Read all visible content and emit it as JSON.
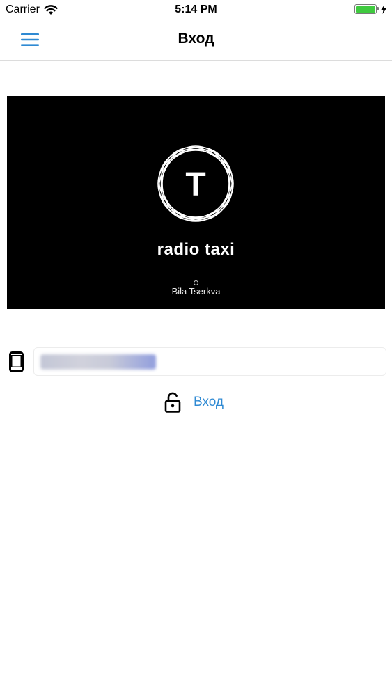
{
  "status_bar": {
    "carrier": "Carrier",
    "time": "5:14 PM",
    "icons": [
      "wifi-icon",
      "battery-icon",
      "charging-bolt-icon"
    ]
  },
  "nav": {
    "title": "Вход",
    "menu_icon": "hamburger-menu-icon"
  },
  "banner": {
    "logo_letter": "T",
    "brand_name": "radio taxi",
    "city": "Bila Tserkva"
  },
  "login": {
    "phone_icon": "smartphone-icon",
    "phone_value": "",
    "lock_icon": "unlock-icon",
    "button_label": "Вход"
  },
  "colors": {
    "accent": "#2f8ad3",
    "battery": "#3fca3f",
    "banner_bg": "#000000"
  }
}
